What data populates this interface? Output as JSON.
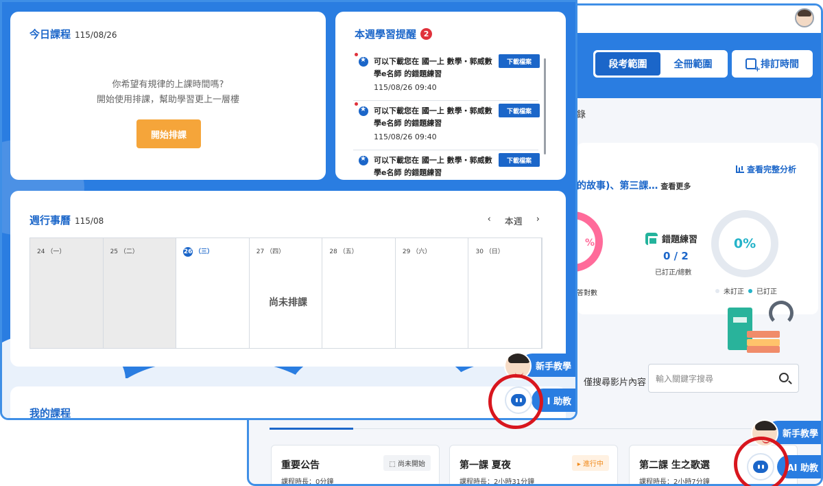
{
  "back": {
    "scope_tabs": [
      "段考範圍",
      "全冊範圍"
    ],
    "schedule_button": "排訂時間",
    "tab_text": "錄",
    "analysis": {
      "link": "查看完整分析",
      "lesson_line": "的故事)、第三課…",
      "more": "查看更多",
      "ring_partial": "%",
      "answered_label": "答對數",
      "error_title": "錯題練習",
      "error_count": "0 / 2",
      "error_sub": "已訂正/總數",
      "progress_percent": "0%",
      "legend_unfixed": "未訂正",
      "legend_fixed": "已訂正"
    },
    "search": {
      "label": "僅搜尋影片內容",
      "placeholder": "輸入關鍵字搜尋"
    },
    "courses": [
      {
        "title": "重要公告",
        "duration": "課程時長：0分鐘",
        "status": "尚未開始"
      },
      {
        "title": "第一課 夏夜",
        "duration": "課程時長：2小時31分鐘",
        "status": "進行中"
      },
      {
        "title": "第二課 生之歌選",
        "duration": "課程時長：2小時7分鐘",
        "status": ""
      }
    ],
    "helpers": {
      "tutorial": "新手教學",
      "ai": "AI 助教"
    }
  },
  "front": {
    "today": {
      "title": "今日課程",
      "date": "115/08/26",
      "msg1": "你希望有規律的上課時間嗎?",
      "msg2": "開始使用排課，幫助學習更上一層樓",
      "start_button": "開始排課"
    },
    "reminder": {
      "title": "本週學習提醒",
      "count": "2",
      "items": [
        {
          "text": "可以下載您在 國一上 數學・郭威數學e名師 的錯題練習",
          "time": "115/08/26 09:40",
          "button": "下載檔案"
        },
        {
          "text": "可以下載您在 國一上 數學・郭威數學e名師 的錯題練習",
          "time": "115/08/26 09:40",
          "button": "下載檔案"
        },
        {
          "text": "可以下載您在 國一上 數學・郭威數學e名師 的錯題練習",
          "time": "",
          "button": "下載檔案"
        }
      ]
    },
    "week": {
      "title": "週行事曆",
      "date": "115/08",
      "prev": "‹",
      "current": "本週",
      "next": "›",
      "days": [
        {
          "num": "24",
          "label": "（一）"
        },
        {
          "num": "25",
          "label": "（二）"
        },
        {
          "num": "26",
          "label": "（三）"
        },
        {
          "num": "27",
          "label": "（四）"
        },
        {
          "num": "28",
          "label": "（五）"
        },
        {
          "num": "29",
          "label": "（六）"
        },
        {
          "num": "30",
          "label": "（日）"
        }
      ],
      "unscheduled": "尚未排課"
    },
    "my_courses": "我的課程",
    "helpers": {
      "tutorial": "新手教學",
      "ai": "I 助教"
    }
  },
  "colors": {
    "primary": "#1b66c9",
    "accent": "#2a7de1",
    "orange": "#f5a53a",
    "alert": "#d8161e"
  }
}
